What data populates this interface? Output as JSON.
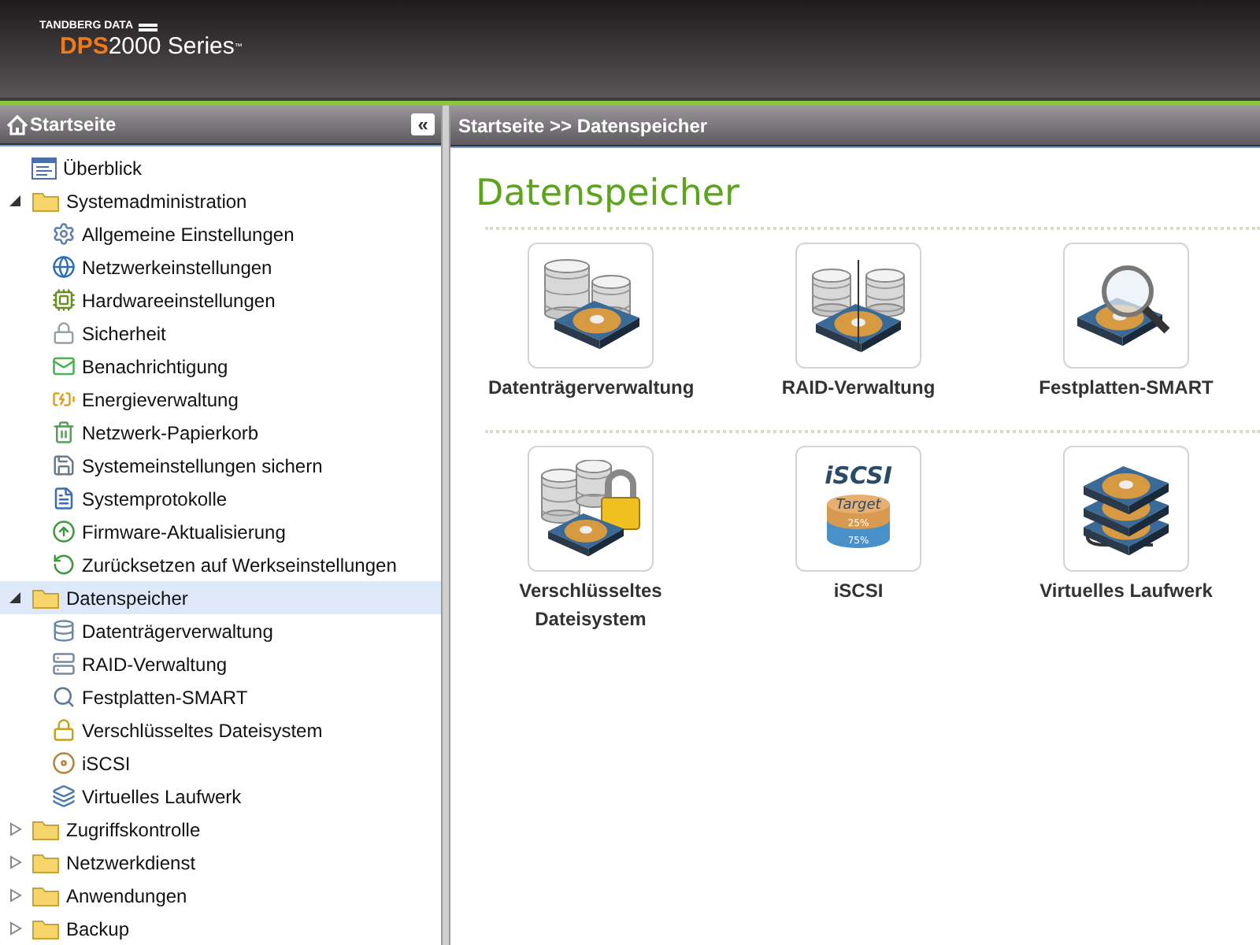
{
  "header": {
    "brand": "TANDBERG DATA",
    "product_bold": "DPS",
    "product_rest": "2000 Series",
    "trademark": "™"
  },
  "sidebar": {
    "title": "Startseite",
    "collapse_label": "«",
    "items": [
      {
        "label": "Überblick",
        "kind": "page",
        "selected": false
      },
      {
        "label": "Systemadministration",
        "kind": "folder",
        "expanded": true,
        "selected": false,
        "children": [
          {
            "label": "Allgemeine Einstellungen",
            "selected": false
          },
          {
            "label": "Netzwerkeinstellungen",
            "selected": false
          },
          {
            "label": "Hardwareeinstellungen",
            "selected": false
          },
          {
            "label": "Sicherheit",
            "selected": false
          },
          {
            "label": "Benachrichtigung",
            "selected": false
          },
          {
            "label": "Energieverwaltung",
            "selected": false
          },
          {
            "label": "Netzwerk-Papierkorb",
            "selected": false
          },
          {
            "label": "Systemeinstellungen sichern",
            "selected": false
          },
          {
            "label": "Systemprotokolle",
            "selected": false
          },
          {
            "label": "Firmware-Aktualisierung",
            "selected": false
          },
          {
            "label": "Zurücksetzen auf Werkseinstellungen",
            "selected": false
          }
        ]
      },
      {
        "label": "Datenspeicher",
        "kind": "folder",
        "expanded": true,
        "selected": true,
        "children": [
          {
            "label": "Datenträgerverwaltung",
            "selected": false
          },
          {
            "label": "RAID-Verwaltung",
            "selected": false
          },
          {
            "label": "Festplatten-SMART",
            "selected": false
          },
          {
            "label": "Verschlüsseltes Dateisystem",
            "selected": false
          },
          {
            "label": "iSCSI",
            "selected": false
          },
          {
            "label": "Virtuelles Laufwerk",
            "selected": false
          }
        ]
      },
      {
        "label": "Zugriffskontrolle",
        "kind": "folder",
        "expanded": false,
        "selected": false
      },
      {
        "label": "Netzwerkdienst",
        "kind": "folder",
        "expanded": false,
        "selected": false
      },
      {
        "label": "Anwendungen",
        "kind": "folder",
        "expanded": false,
        "selected": false
      },
      {
        "label": "Backup",
        "kind": "folder",
        "expanded": false,
        "selected": false
      }
    ]
  },
  "main": {
    "breadcrumb": "Startseite >> Datenspeicher",
    "title": "Datenspeicher",
    "sections": [
      {
        "tiles": [
          {
            "label": "Datenträgerverwaltung",
            "kind": "disks"
          },
          {
            "label": "RAID-Verwaltung",
            "kind": "raid"
          },
          {
            "label": "Festplatten-SMART",
            "kind": "smart"
          }
        ]
      },
      {
        "tiles": [
          {
            "label": "Verschlüsseltes Dateisystem",
            "kind": "encrypted"
          },
          {
            "label": "iSCSI",
            "kind": "iscsi",
            "icon_texts": [
              "iSCSI",
              "Target",
              "25%",
              "75%"
            ]
          },
          {
            "label": "Virtuelles Laufwerk",
            "kind": "virtual"
          }
        ]
      }
    ]
  }
}
